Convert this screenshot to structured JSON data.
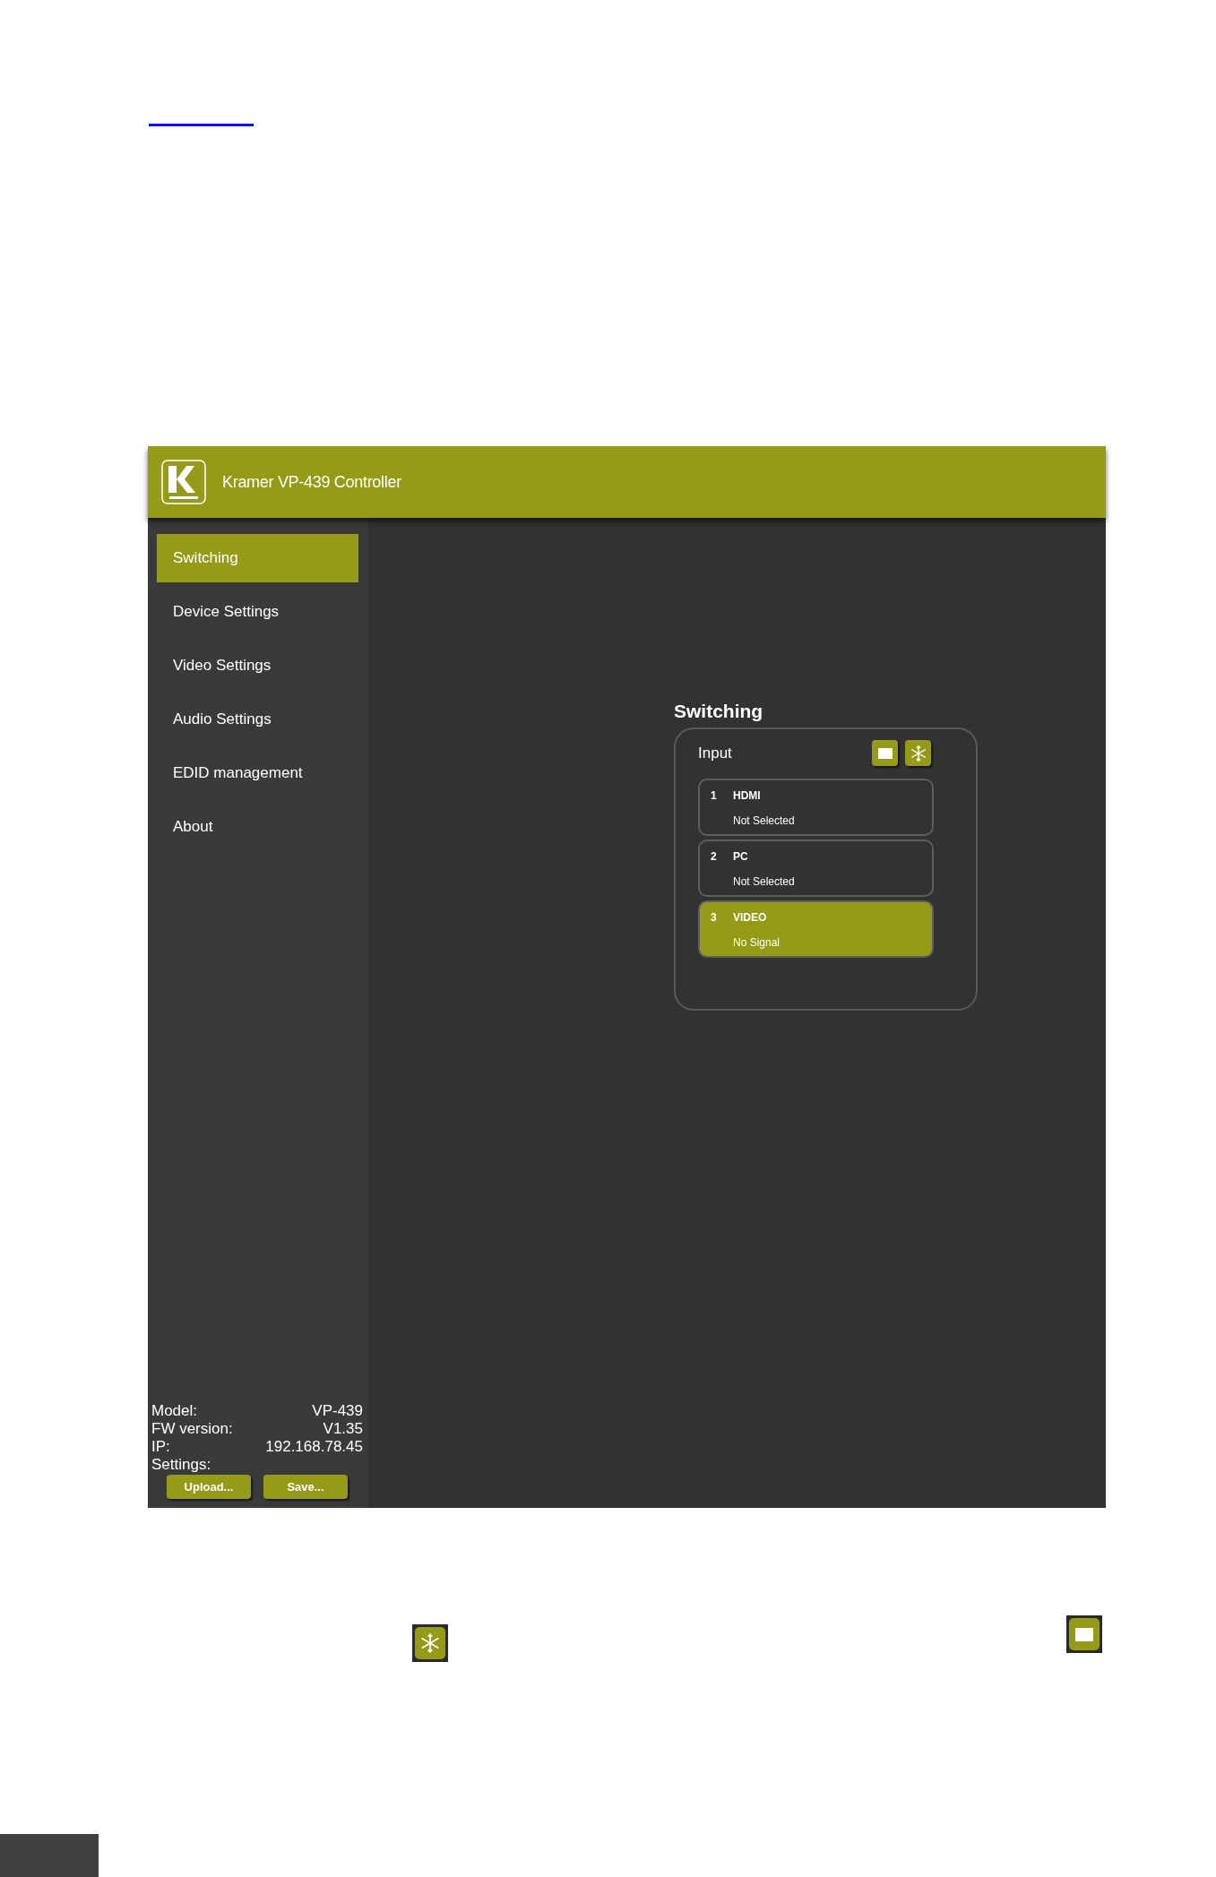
{
  "header": {
    "title": "Kramer VP-439 Controller"
  },
  "nav": [
    {
      "label": "Switching",
      "selected": true
    },
    {
      "label": "Device Settings",
      "selected": false
    },
    {
      "label": "Video Settings",
      "selected": false
    },
    {
      "label": "Audio Settings",
      "selected": false
    },
    {
      "label": "EDID management",
      "selected": false
    },
    {
      "label": "About",
      "selected": false
    }
  ],
  "info": [
    {
      "label": "Model:",
      "value": "VP-439"
    },
    {
      "label": "FW version:",
      "value": "V1.35"
    },
    {
      "label": "IP:",
      "value": "192.168.78.45"
    }
  ],
  "settings": {
    "label": "Settings:",
    "buttons": [
      "Upload...",
      "Save..."
    ]
  },
  "switching": {
    "title": "Switching",
    "section": "Input",
    "inputs": [
      {
        "number": "1",
        "name": "HDMI",
        "status": "Not Selected",
        "selected": false
      },
      {
        "number": "2",
        "name": "PC",
        "status": "Not Selected",
        "selected": false
      },
      {
        "number": "3",
        "name": "VIDEO",
        "status": "No Signal",
        "selected": true
      }
    ]
  }
}
